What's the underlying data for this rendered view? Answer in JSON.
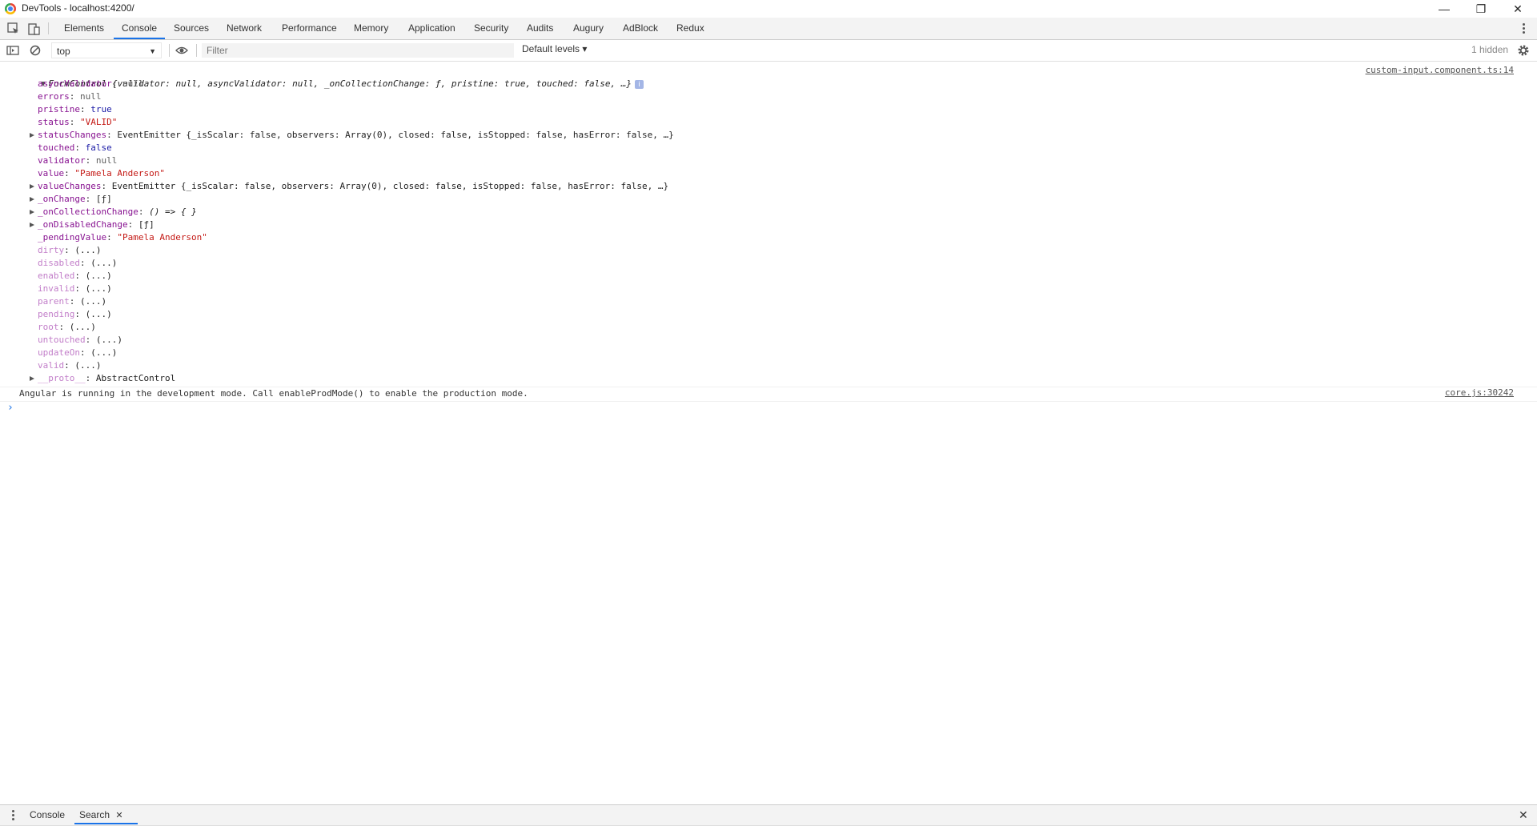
{
  "window": {
    "title": "DevTools - localhost:4200/",
    "minimize": "—",
    "maximize": "❐",
    "close": "✕"
  },
  "tabs": [
    "Elements",
    "Console",
    "Sources",
    "Network",
    "Performance",
    "Memory",
    "Application",
    "Security",
    "Audits",
    "Augury",
    "AdBlock",
    "Redux"
  ],
  "active_tab": "Console",
  "toolbar": {
    "context": "top",
    "filter_placeholder": "Filter",
    "levels": "Default levels ▾",
    "hidden_count": "1 hidden"
  },
  "console": {
    "object_log": {
      "summary_name": "FormControl",
      "summary_text": "{validator: null, asyncValidator: null, _onCollectionChange: ƒ, pristine: true, touched: false, …}",
      "source": "custom-input.component.ts:14",
      "props": [
        {
          "key": "asyncValidator",
          "sep": ": ",
          "value": "null",
          "vtype": "n",
          "expand": false,
          "keystyle": "k"
        },
        {
          "key": "errors",
          "sep": ": ",
          "value": "null",
          "vtype": "n",
          "expand": false,
          "keystyle": "k"
        },
        {
          "key": "pristine",
          "sep": ": ",
          "value": "true",
          "vtype": "b",
          "expand": false,
          "keystyle": "k"
        },
        {
          "key": "status",
          "sep": ": ",
          "value": "\"VALID\"",
          "vtype": "s",
          "expand": false,
          "keystyle": "k"
        },
        {
          "key": "statusChanges",
          "sep": ": ",
          "value": "EventEmitter {_isScalar: false, observers: Array(0), closed: false, isStopped: false, hasError: false, …}",
          "vtype": "obj",
          "expand": true,
          "keystyle": "k"
        },
        {
          "key": "touched",
          "sep": ": ",
          "value": "false",
          "vtype": "b",
          "expand": false,
          "keystyle": "k"
        },
        {
          "key": "validator",
          "sep": ": ",
          "value": "null",
          "vtype": "n",
          "expand": false,
          "keystyle": "k"
        },
        {
          "key": "value",
          "sep": ": ",
          "value": "\"Pamela Anderson\"",
          "vtype": "s",
          "expand": false,
          "keystyle": "k"
        },
        {
          "key": "valueChanges",
          "sep": ": ",
          "value": "EventEmitter {_isScalar: false, observers: Array(0), closed: false, isStopped: false, hasError: false, …}",
          "vtype": "obj",
          "expand": true,
          "keystyle": "k"
        },
        {
          "key": "_onChange",
          "sep": ": ",
          "value": "[ƒ]",
          "vtype": "obj",
          "expand": true,
          "keystyle": "k"
        },
        {
          "key": "_onCollectionChange",
          "sep": ": ",
          "value": "() => { }",
          "vtype": "fn",
          "expand": true,
          "keystyle": "k"
        },
        {
          "key": "_onDisabledChange",
          "sep": ": ",
          "value": "[ƒ]",
          "vtype": "obj",
          "expand": true,
          "keystyle": "k"
        },
        {
          "key": "_pendingValue",
          "sep": ": ",
          "value": "\"Pamela Anderson\"",
          "vtype": "s",
          "expand": false,
          "keystyle": "k"
        },
        {
          "key": "dirty",
          "sep": ": ",
          "value": "(...)",
          "vtype": "obj",
          "expand": false,
          "keystyle": "kd"
        },
        {
          "key": "disabled",
          "sep": ": ",
          "value": "(...)",
          "vtype": "obj",
          "expand": false,
          "keystyle": "kd"
        },
        {
          "key": "enabled",
          "sep": ": ",
          "value": "(...)",
          "vtype": "obj",
          "expand": false,
          "keystyle": "kd"
        },
        {
          "key": "invalid",
          "sep": ": ",
          "value": "(...)",
          "vtype": "obj",
          "expand": false,
          "keystyle": "kd"
        },
        {
          "key": "parent",
          "sep": ": ",
          "value": "(...)",
          "vtype": "obj",
          "expand": false,
          "keystyle": "kd"
        },
        {
          "key": "pending",
          "sep": ": ",
          "value": "(...)",
          "vtype": "obj",
          "expand": false,
          "keystyle": "kd"
        },
        {
          "key": "root",
          "sep": ": ",
          "value": "(...)",
          "vtype": "obj",
          "expand": false,
          "keystyle": "kd"
        },
        {
          "key": "untouched",
          "sep": ": ",
          "value": "(...)",
          "vtype": "obj",
          "expand": false,
          "keystyle": "kd"
        },
        {
          "key": "updateOn",
          "sep": ": ",
          "value": "(...)",
          "vtype": "obj",
          "expand": false,
          "keystyle": "kd"
        },
        {
          "key": "valid",
          "sep": ": ",
          "value": "(...)",
          "vtype": "obj",
          "expand": false,
          "keystyle": "kd"
        },
        {
          "key": "__proto__",
          "sep": ": ",
          "value": "AbstractControl",
          "vtype": "obj",
          "expand": true,
          "keystyle": "kd"
        }
      ]
    },
    "message": "Angular is running in the development mode. Call enableProdMode() to enable the production mode.",
    "message_source": "core.js:30242",
    "prompt": "›"
  },
  "drawer": {
    "tabs": [
      "Console",
      "Search"
    ],
    "active_tab": "Search",
    "close_tab": "✕",
    "close": "✕"
  },
  "colors": {
    "accent": "#1a73e8",
    "prop_key": "#881391",
    "getter_key": "#c27ec9",
    "string": "#c41a16",
    "boolean": "#1a1aa6"
  }
}
